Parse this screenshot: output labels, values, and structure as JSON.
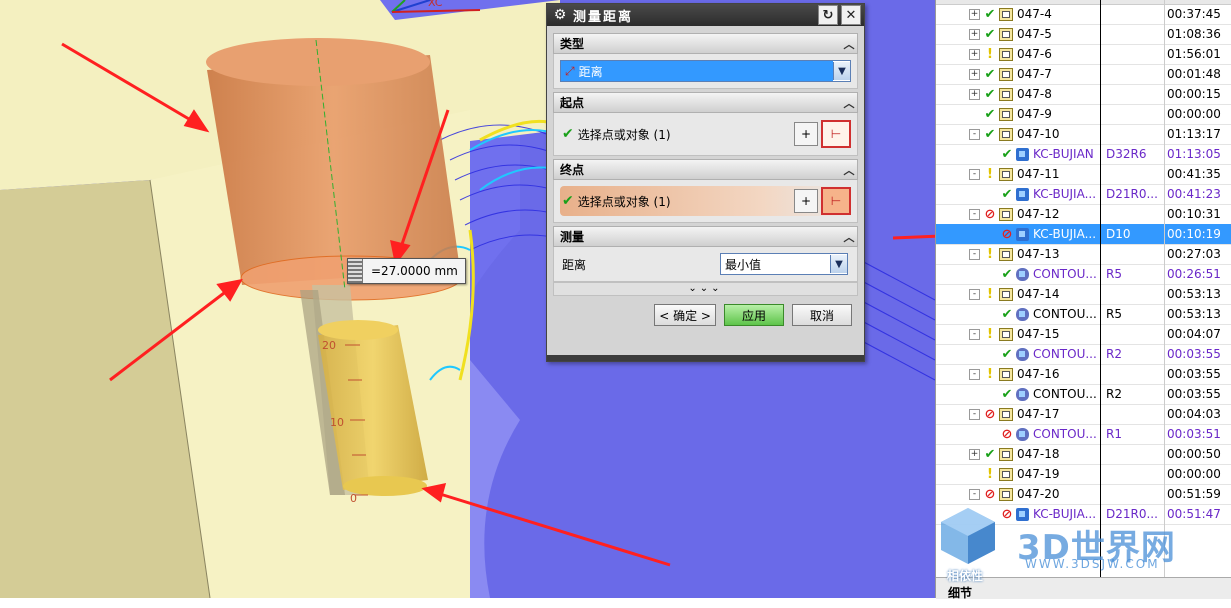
{
  "viewport": {
    "measure_value": "=27.0000 mm",
    "axis_label": "XC",
    "scale_ticks": [
      "20",
      "10",
      "0"
    ]
  },
  "dialog": {
    "title": "测量距离",
    "sections": {
      "type": {
        "header": "类型",
        "selected": "距离"
      },
      "start": {
        "header": "起点",
        "select_label": "选择点或对象 (1)"
      },
      "end": {
        "header": "终点",
        "select_label": "选择点或对象 (1)"
      },
      "measure": {
        "header": "测量",
        "label": "距离",
        "selected": "最小值"
      }
    },
    "expand_glyph": "⌄⌄⌄",
    "buttons": {
      "ok": "< 确定 >",
      "apply": "应用",
      "cancel": "取消"
    }
  },
  "navigator": {
    "rows": [
      {
        "indent": 1,
        "expander": "+",
        "status": "ok",
        "icon": "folder",
        "name": "047-4",
        "tool": "",
        "time": "00:37:45"
      },
      {
        "indent": 1,
        "expander": "+",
        "status": "ok",
        "icon": "folder",
        "name": "047-5",
        "tool": "",
        "time": "01:08:36"
      },
      {
        "indent": 1,
        "expander": "+",
        "status": "warn",
        "icon": "folder",
        "name": "047-6",
        "tool": "",
        "time": "01:56:01"
      },
      {
        "indent": 1,
        "expander": "+",
        "status": "ok",
        "icon": "folder",
        "name": "047-7",
        "tool": "",
        "time": "00:01:48"
      },
      {
        "indent": 1,
        "expander": "+",
        "status": "ok",
        "icon": "folder",
        "name": "047-8",
        "tool": "",
        "time": "00:00:15"
      },
      {
        "indent": 1,
        "expander": "",
        "status": "ok",
        "icon": "folder",
        "name": "047-9",
        "tool": "",
        "time": "00:00:00"
      },
      {
        "indent": 1,
        "expander": "-",
        "status": "ok",
        "icon": "folder",
        "name": "047-10",
        "tool": "",
        "time": "01:13:17"
      },
      {
        "indent": 2,
        "expander": "",
        "status": "ok",
        "icon": "op",
        "name": "KC-BUJIAN",
        "tool": "D32R6",
        "time": "01:13:05",
        "purple": true
      },
      {
        "indent": 1,
        "expander": "-",
        "status": "warn",
        "icon": "folder",
        "name": "047-11",
        "tool": "",
        "time": "00:41:35"
      },
      {
        "indent": 2,
        "expander": "",
        "status": "ok",
        "icon": "op",
        "name": "KC-BUJIA...",
        "tool": "D21R0...",
        "time": "00:41:23",
        "purple": true
      },
      {
        "indent": 1,
        "expander": "-",
        "status": "no",
        "icon": "folder",
        "name": "047-12",
        "tool": "",
        "time": "00:10:31"
      },
      {
        "indent": 2,
        "expander": "",
        "status": "no",
        "icon": "op",
        "name": "KC-BUJIA...",
        "tool": "D10",
        "time": "00:10:19",
        "selected": true
      },
      {
        "indent": 1,
        "expander": "-",
        "status": "warn",
        "icon": "folder",
        "name": "047-13",
        "tool": "",
        "time": "00:27:03"
      },
      {
        "indent": 2,
        "expander": "",
        "status": "ok",
        "icon": "contour",
        "name": "CONTOU...",
        "tool": "R5",
        "time": "00:26:51",
        "purple": true
      },
      {
        "indent": 1,
        "expander": "-",
        "status": "warn",
        "icon": "folder",
        "name": "047-14",
        "tool": "",
        "time": "00:53:13"
      },
      {
        "indent": 2,
        "expander": "",
        "status": "ok",
        "icon": "contour",
        "name": "CONTOU...",
        "tool": "R5",
        "time": "00:53:13"
      },
      {
        "indent": 1,
        "expander": "-",
        "status": "warn",
        "icon": "folder",
        "name": "047-15",
        "tool": "",
        "time": "00:04:07"
      },
      {
        "indent": 2,
        "expander": "",
        "status": "ok",
        "icon": "contour",
        "name": "CONTOU...",
        "tool": "R2",
        "time": "00:03:55",
        "purple": true
      },
      {
        "indent": 1,
        "expander": "-",
        "status": "warn",
        "icon": "folder",
        "name": "047-16",
        "tool": "",
        "time": "00:03:55"
      },
      {
        "indent": 2,
        "expander": "",
        "status": "ok",
        "icon": "contour",
        "name": "CONTOU...",
        "tool": "R2",
        "time": "00:03:55"
      },
      {
        "indent": 1,
        "expander": "-",
        "status": "no",
        "icon": "folder",
        "name": "047-17",
        "tool": "",
        "time": "00:04:03"
      },
      {
        "indent": 2,
        "expander": "",
        "status": "no",
        "icon": "contour",
        "name": "CONTOU...",
        "tool": "R1",
        "time": "00:03:51",
        "purple": true
      },
      {
        "indent": 1,
        "expander": "+",
        "status": "ok",
        "icon": "folder",
        "name": "047-18",
        "tool": "",
        "time": "00:00:50"
      },
      {
        "indent": 1,
        "expander": "",
        "status": "warn",
        "icon": "folder",
        "name": "047-19",
        "tool": "",
        "time": "00:00:00"
      },
      {
        "indent": 1,
        "expander": "-",
        "status": "no",
        "icon": "folder",
        "name": "047-20",
        "tool": "",
        "time": "00:51:59"
      },
      {
        "indent": 2,
        "expander": "",
        "status": "no",
        "icon": "op",
        "name": "KC-BUJIA...",
        "tool": "D21R0...",
        "time": "00:51:47",
        "purple": true
      }
    ],
    "footer_label": "细节"
  },
  "watermark": {
    "brand": "3D世界网",
    "url": "WWW.3DSJW.COM",
    "tagline": "相依性"
  },
  "colors": {
    "selection": "#3399ff",
    "ok": "#18a018",
    "warn": "#e2c400",
    "no": "#e02020",
    "viewport_blue": "#6b6bea"
  }
}
